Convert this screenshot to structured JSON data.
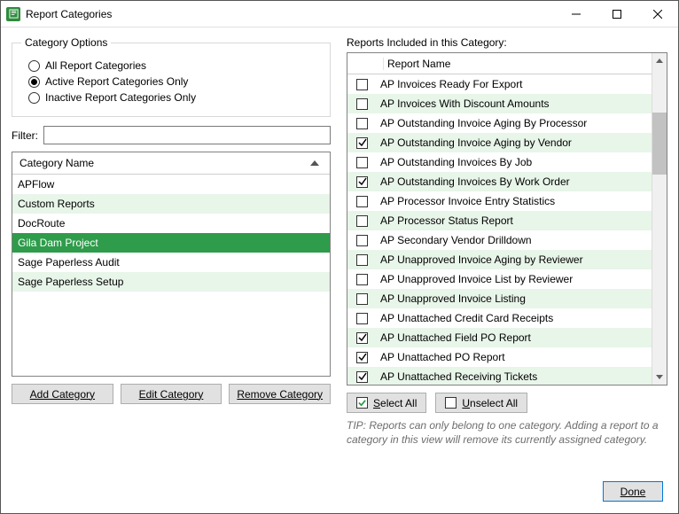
{
  "window": {
    "title": "Report Categories"
  },
  "category_options": {
    "legend": "Category Options",
    "radios": [
      {
        "label": "All Report Categories",
        "checked": false
      },
      {
        "label": "Active Report Categories Only",
        "checked": true
      },
      {
        "label": "Inactive Report Categories Only",
        "checked": false
      }
    ]
  },
  "filter": {
    "label": "Filter:",
    "value": ""
  },
  "category_list": {
    "header": "Category Name",
    "items": [
      {
        "name": "APFlow",
        "selected": false
      },
      {
        "name": "Custom Reports",
        "selected": false
      },
      {
        "name": "DocRoute",
        "selected": false
      },
      {
        "name": "Gila Dam Project",
        "selected": true
      },
      {
        "name": "Sage Paperless Audit",
        "selected": false
      },
      {
        "name": "Sage Paperless Setup",
        "selected": false
      }
    ]
  },
  "category_buttons": {
    "add": "Add Category",
    "edit": "Edit Category",
    "remove": "Remove Category"
  },
  "reports_label": "Reports Included in this Category:",
  "reports": {
    "header": "Report Name",
    "items": [
      {
        "name": "AP Invoices Ready For Export",
        "checked": false
      },
      {
        "name": "AP Invoices With Discount Amounts",
        "checked": false
      },
      {
        "name": "AP Outstanding Invoice Aging By Processor",
        "checked": false
      },
      {
        "name": "AP Outstanding Invoice Aging by Vendor",
        "checked": true
      },
      {
        "name": "AP Outstanding Invoices By Job",
        "checked": false
      },
      {
        "name": "AP Outstanding Invoices By Work Order",
        "checked": true
      },
      {
        "name": "AP Processor Invoice Entry Statistics",
        "checked": false
      },
      {
        "name": "AP Processor Status Report",
        "checked": false
      },
      {
        "name": "AP Secondary Vendor Drilldown",
        "checked": false
      },
      {
        "name": "AP Unapproved Invoice Aging by Reviewer",
        "checked": false
      },
      {
        "name": "AP Unapproved Invoice List by Reviewer",
        "checked": false
      },
      {
        "name": "AP Unapproved Invoice Listing",
        "checked": false
      },
      {
        "name": "AP Unattached Credit Card Receipts",
        "checked": false
      },
      {
        "name": "AP Unattached Field PO Report",
        "checked": true
      },
      {
        "name": "AP Unattached PO Report",
        "checked": true
      },
      {
        "name": "AP Unattached Receiving Tickets",
        "checked": true
      }
    ]
  },
  "select_buttons": {
    "select_all": "Select All",
    "unselect_all": "Unselect All"
  },
  "tip": "TIP:  Reports can only belong to one category.  Adding a report to a category in this view will remove its currently assigned category.",
  "done": "Done"
}
